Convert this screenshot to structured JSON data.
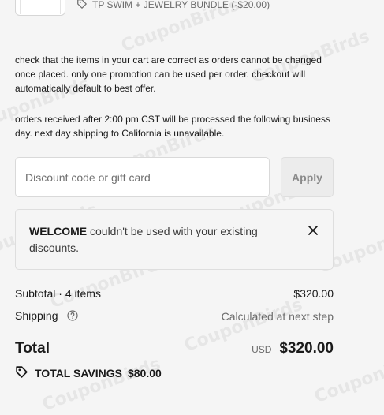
{
  "watermark": "CouponBirds",
  "line_item": {
    "discount_label": "TP SWIM + JEWELRY BUNDLE (-$20.00)"
  },
  "notes": {
    "cart_check": "check that the items in your cart are correct as orders cannot be changed once placed. only one promotion can be used per order. checkout will automatically default to best offer.",
    "shipping_cutoff": "orders received after 2:00 pm CST will be processed the following business day. next day shipping to California is unavailable."
  },
  "discount": {
    "placeholder": "Discount code or gift card",
    "value": "",
    "apply_label": "Apply"
  },
  "alert": {
    "code": "WELCOME",
    "message": " couldn't be used with your existing discounts."
  },
  "summary": {
    "subtotal_label": "Subtotal · 4 items",
    "subtotal_value": "$320.00",
    "shipping_label": "Shipping",
    "shipping_value": "Calculated at next step",
    "total_label": "Total",
    "currency": "USD",
    "total_value": "$320.00",
    "savings_label": "TOTAL SAVINGS",
    "savings_value": "$80.00"
  },
  "colors": {
    "background": "#f5f5f5",
    "text": "#1a1a1a",
    "muted": "#6b6b6b",
    "border": "#d9d9d9"
  }
}
